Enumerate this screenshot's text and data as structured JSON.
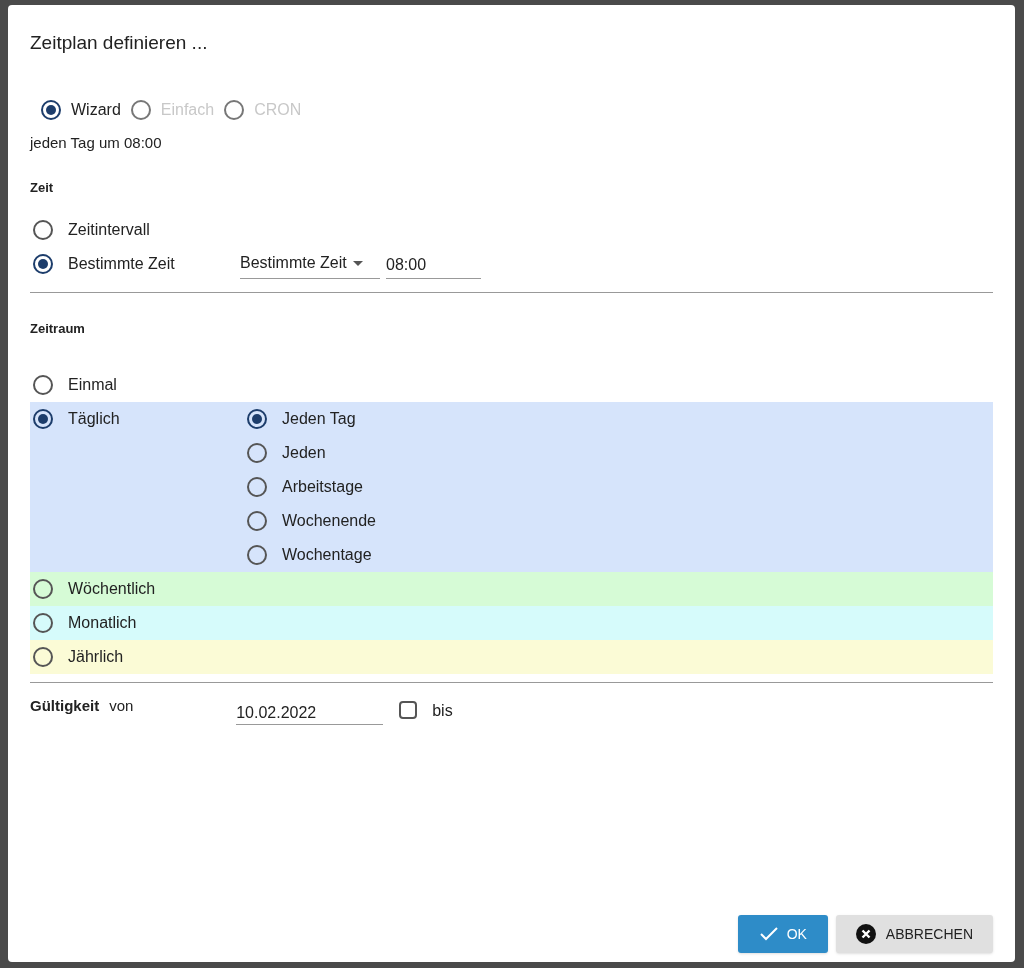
{
  "dialog": {
    "title": "Zeitplan definieren ..."
  },
  "modes": [
    {
      "label": "Wizard",
      "selected": true,
      "disabled": false
    },
    {
      "label": "Einfach",
      "selected": false,
      "disabled": true
    },
    {
      "label": "CRON",
      "selected": false,
      "disabled": true
    }
  ],
  "summary": "jeden Tag um 08:00",
  "time": {
    "heading": "Zeit",
    "options": [
      {
        "label": "Zeitintervall",
        "selected": false
      },
      {
        "label": "Bestimmte Zeit",
        "selected": true
      }
    ],
    "dropdown": "Bestimmte Zeit",
    "value": "08:00"
  },
  "period": {
    "heading": "Zeitraum",
    "options": [
      {
        "label": "Einmal",
        "selected": false
      },
      {
        "label": "Täglich",
        "selected": true,
        "color": "#d6e4fb",
        "sub_options": [
          {
            "label": "Jeden Tag",
            "selected": true
          },
          {
            "label": "Jeden",
            "selected": false
          },
          {
            "label": "Arbeitstage",
            "selected": false
          },
          {
            "label": "Wochenende",
            "selected": false
          },
          {
            "label": "Wochentage",
            "selected": false
          }
        ]
      },
      {
        "label": "Wöchentlich",
        "selected": false,
        "color": "#d6fbd6"
      },
      {
        "label": "Monatlich",
        "selected": false,
        "color": "#d6fbfb"
      },
      {
        "label": "Jährlich",
        "selected": false,
        "color": "#fbfbd6"
      }
    ]
  },
  "validity": {
    "label": "Gültigkeit",
    "from_label": "von",
    "from": "10.02.2022",
    "until_checked": false,
    "until_label": "bis"
  },
  "buttons": [
    {
      "label": "OK",
      "kind": "primary"
    },
    {
      "label": "ABBRECHEN",
      "kind": "cancel"
    }
  ]
}
